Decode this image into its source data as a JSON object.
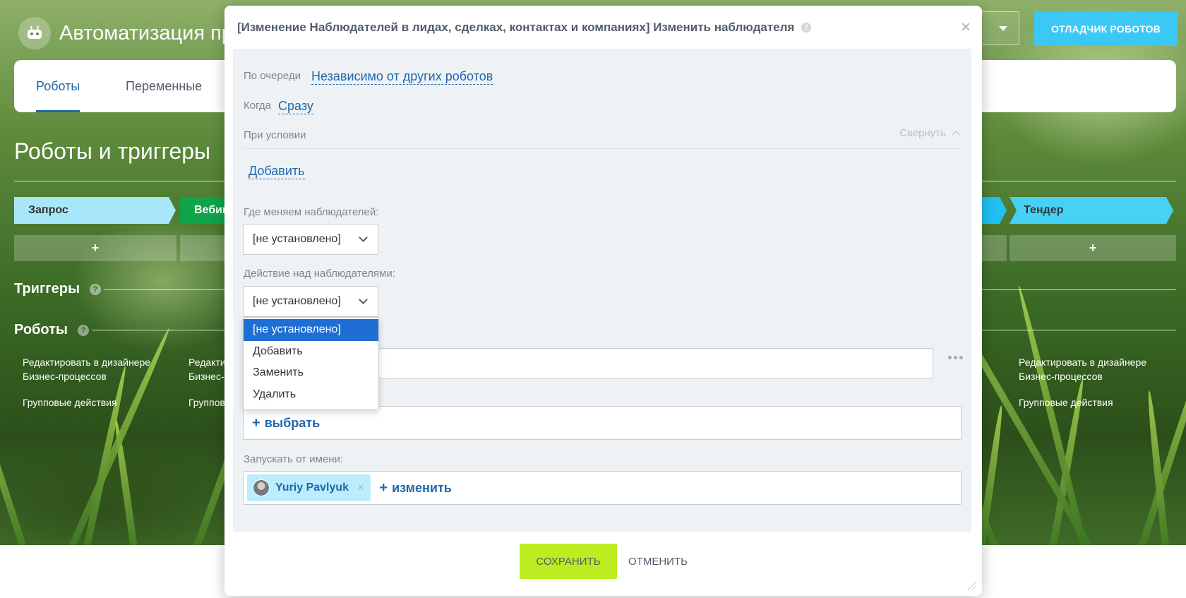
{
  "page": {
    "title": "Автоматизация пр",
    "debugger_label": "ОТЛАДЧИК РОБОТОВ",
    "tabs": [
      {
        "label": "Роботы"
      },
      {
        "label": "Переменные"
      }
    ],
    "section_title": "Роботы и триггеры",
    "stages": [
      {
        "label": "Запрос"
      },
      {
        "label": "Вебин"
      },
      {
        "label": "Тендер"
      }
    ],
    "add_symbol": "+",
    "triggers_heading": "Триггеры",
    "robots_heading": "Роботы",
    "help_symbol": "?",
    "columns": [
      {
        "edit_line1": "Редактировать в дизайнере",
        "edit_line2": "Бизнес-процессов",
        "group": "Групповые действия"
      },
      {
        "edit_line1": "Редакти",
        "edit_line2": "Бизнес-",
        "group": "Группов"
      },
      {
        "edit_line1": "Редактировать в дизайнере",
        "edit_line2": "Бизнес-процессов",
        "group": "Групповые действия"
      }
    ]
  },
  "modal": {
    "title": "[Изменение Наблюдателей в лидах, сделках, контактах и компаниях] Изменить наблюдателя",
    "close_symbol": "×",
    "queue_label": "По очереди",
    "queue_value": "Независимо от других роботов",
    "when_label": "Когда",
    "when_value": "Сразу",
    "condition_label": "При условии",
    "collapse_label": "Свернуть",
    "add_condition": "Добавить",
    "where_label": "Где меняем наблюдателей:",
    "where_value": "[не установлено]",
    "action_label": "Действие над наблюдателями:",
    "action_value": "[не установлено]",
    "action_options": [
      "[не установлено]",
      "Добавить",
      "Заменить",
      "Удалить"
    ],
    "select_plus": "+",
    "select_label": "выбрать",
    "run_as_label": "Запускать от имени:",
    "run_as_user": "Yuriy Pavlyuk",
    "chip_remove": "×",
    "change_label": "изменить",
    "save_label": "СОХРАНИТЬ",
    "cancel_label": "ОТМЕНИТЬ"
  },
  "colors": {
    "accent_blue": "#2067b0",
    "debugger_button": "#3bc8f5",
    "save_button": "#bbed21",
    "selected_option": "#1e6ed3",
    "stage_light": "#a7e7f9",
    "stage_green": "#0fa34a",
    "stage_cyan": "#47d1f5"
  }
}
